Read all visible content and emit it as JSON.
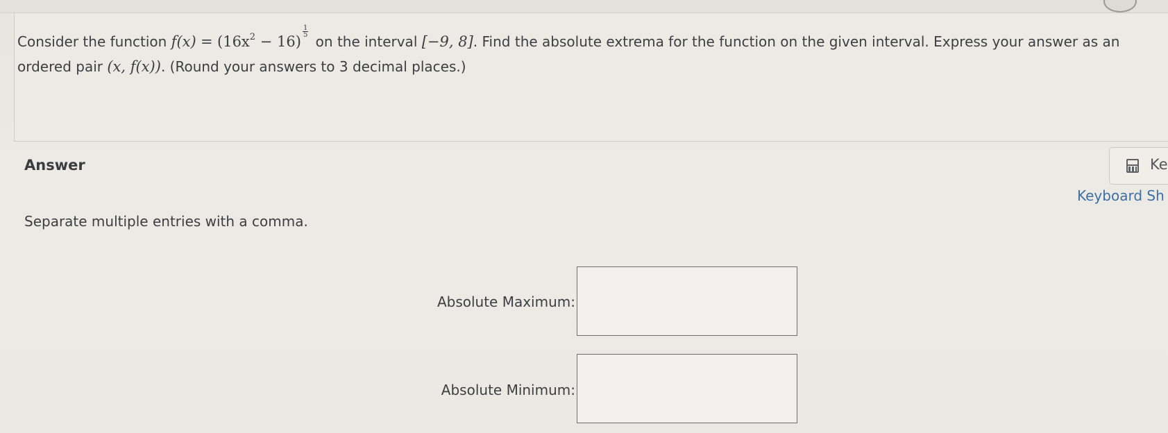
{
  "question": {
    "prefix": "Consider the function",
    "func_lhs": "f(x)",
    "eq": "=",
    "base_open": "(16x",
    "exp2": "2",
    "base_close": " − 16)",
    "frac_num": "1",
    "frac_den": "5",
    "mid_text": "on the interval",
    "interval": "[−9, 8]",
    "suffix": ". Find the absolute extrema for the function on the given interval. Express your answer as an ordered pair",
    "pair": "(x, f(x))",
    "tail": ". (Round your answers to 3 decimal places.)"
  },
  "answer": {
    "heading": "Answer",
    "instruction": "Separate multiple entries with a comma.",
    "max_label": "Absolute Maximum:",
    "min_label": "Absolute Minimum:",
    "max_value": "",
    "min_value": ""
  },
  "keypad": {
    "button_label": "Ke",
    "shortcuts_link": "Keyboard Sh",
    "icon": "calculator-icon"
  }
}
